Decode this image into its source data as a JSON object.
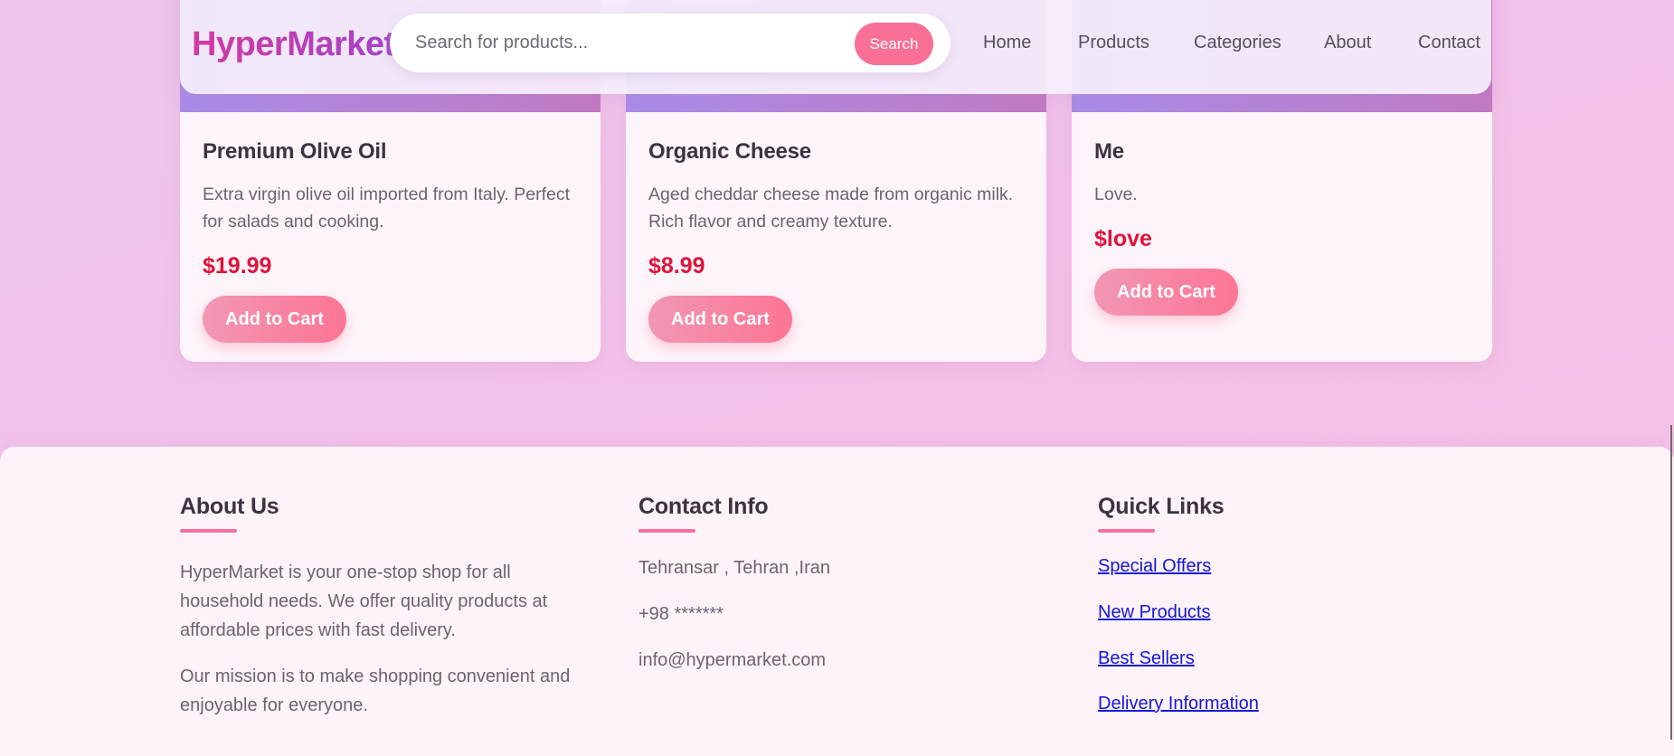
{
  "header": {
    "logo": "HyperMarket",
    "search_placeholder": "Search for products...",
    "search_button": "Search",
    "nav": [
      "Home",
      "Products",
      "Categories",
      "About",
      "Contact"
    ]
  },
  "products": [
    {
      "title": "Premium Olive Oil",
      "description": "Extra virgin olive oil imported from Italy. Perfect for salads and cooking.",
      "price": "$19.99",
      "button": "Add to Cart"
    },
    {
      "title": "Organic Cheese",
      "description": "Aged cheddar cheese made from organic milk. Rich flavor and creamy texture.",
      "price": "$8.99",
      "button": "Add to Cart"
    },
    {
      "title": "Me",
      "description": "Love.",
      "price": "$love",
      "button": "Add to Cart"
    }
  ],
  "footer": {
    "about": {
      "heading": "About Us",
      "paragraphs": [
        "HyperMarket is your one-stop shop for all household needs. We offer quality products at affordable prices with fast delivery.",
        "Our mission is to make shopping convenient and enjoyable for everyone."
      ]
    },
    "contact": {
      "heading": "Contact Info",
      "lines": [
        "Tehransar , Tehran ,Iran",
        "+98 *******",
        "info@hypermarket.com"
      ]
    },
    "links": {
      "heading": "Quick Links",
      "items": [
        "Special Offers",
        "New Products",
        "Best Sellers",
        "Delivery Information"
      ]
    }
  },
  "colors": {
    "accent": "#fa6f95",
    "price": "#e0143c",
    "link": "#1515d8"
  }
}
